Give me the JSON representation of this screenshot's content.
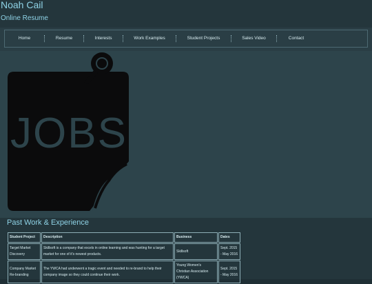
{
  "header": {
    "title": "Noah Cail",
    "subtitle": "Online Resume"
  },
  "nav": {
    "items": [
      "Home",
      "Resume",
      "Interests",
      "Work Examples",
      "Student Projects",
      "Sales Video",
      "Contact"
    ]
  },
  "hero": {
    "jobs_text": "JOBS"
  },
  "section": {
    "title": "Past Work & Experience"
  },
  "table": {
    "headers": [
      "Student Project",
      "Description",
      "Business",
      "Dates"
    ],
    "rows": [
      [
        "Target Market Discovery",
        "Skillsoft is a company that excels in online learning and was hunting for a target market for one of it's newest products.",
        "Skillsoft",
        "Sept. 2015 - May 2016"
      ],
      [
        "Company Market Re-branding",
        "The YWCA had underwent a tragic event and needed to re-brand to help their company image so they could continue their work.",
        "Young Women's Christian Association (YWCA)",
        "Sept. 2015 - May 2016"
      ]
    ]
  },
  "colors": {
    "accent": "#8fd3e6",
    "background": "#1f2f35"
  }
}
